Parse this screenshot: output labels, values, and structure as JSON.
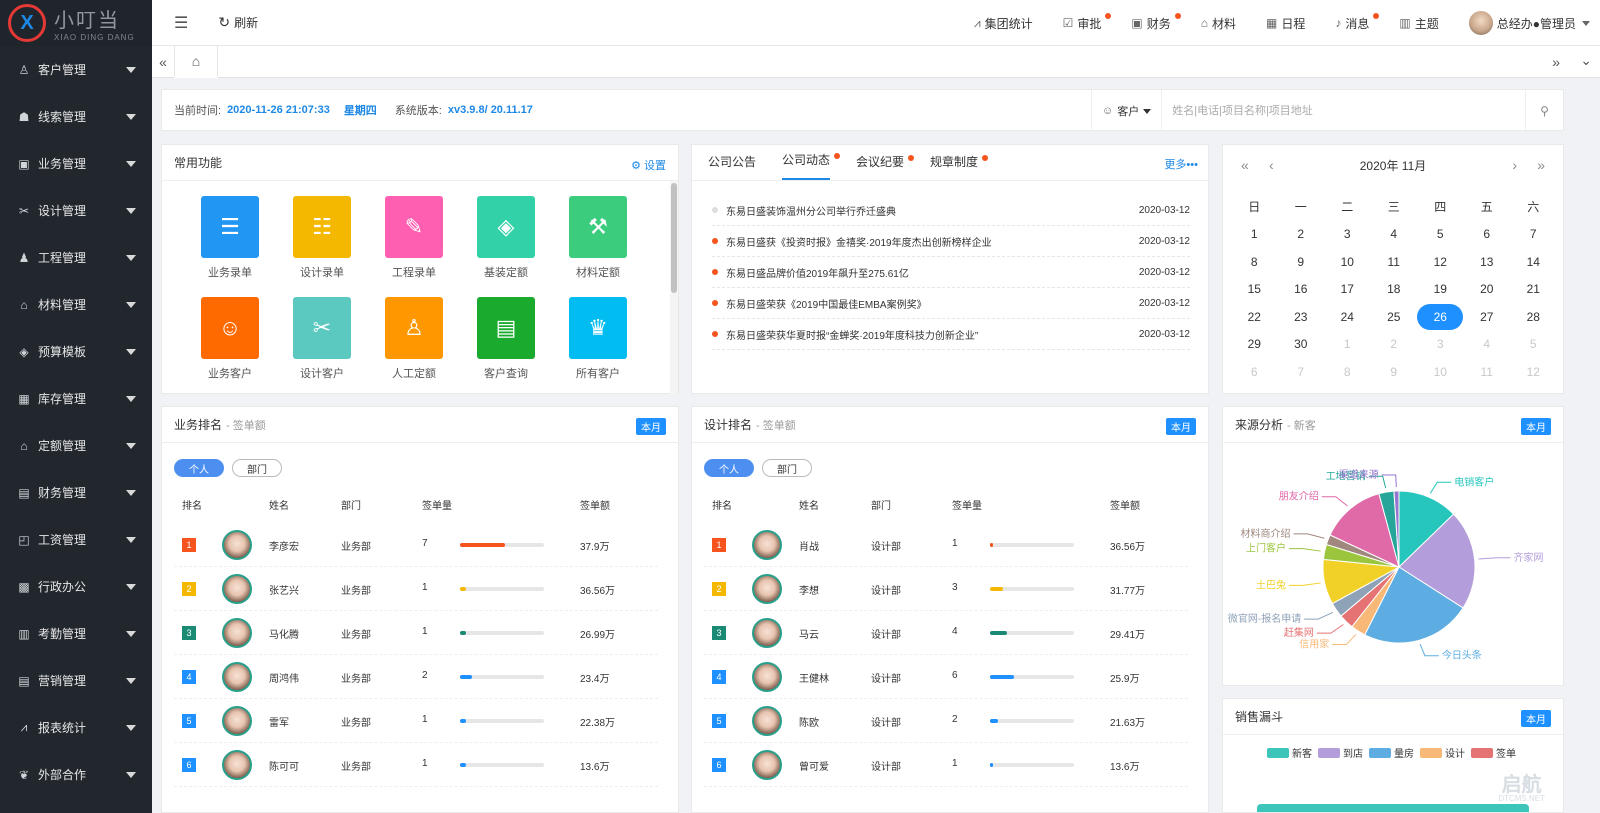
{
  "logo": {
    "title": "小叮当",
    "subtitle": "XIAO DING DANG",
    "mark": "X"
  },
  "sidebar": {
    "items": [
      {
        "label": "客户管理",
        "icon": "user-icon"
      },
      {
        "label": "线索管理",
        "icon": "lead-icon"
      },
      {
        "label": "业务管理",
        "icon": "briefcase-icon"
      },
      {
        "label": "设计管理",
        "icon": "design-icon"
      },
      {
        "label": "工程管理",
        "icon": "worker-icon"
      },
      {
        "label": "材料管理",
        "icon": "material-icon"
      },
      {
        "label": "预算模板",
        "icon": "layers-icon"
      },
      {
        "label": "库存管理",
        "icon": "inventory-icon"
      },
      {
        "label": "定额管理",
        "icon": "quota-icon"
      },
      {
        "label": "财务管理",
        "icon": "finance-icon"
      },
      {
        "label": "工资管理",
        "icon": "salary-icon"
      },
      {
        "label": "行政办公",
        "icon": "office-icon"
      },
      {
        "label": "考勤管理",
        "icon": "attendance-icon"
      },
      {
        "label": "营销管理",
        "icon": "marketing-icon"
      },
      {
        "label": "报表统计",
        "icon": "chart-icon"
      },
      {
        "label": "外部合作",
        "icon": "handshake-icon"
      }
    ]
  },
  "topbar": {
    "refresh": "刷新",
    "items": [
      {
        "label": "集团统计",
        "dot": false
      },
      {
        "label": "审批",
        "dot": true
      },
      {
        "label": "财务",
        "dot": true
      },
      {
        "label": "材料",
        "dot": false
      },
      {
        "label": "日程",
        "dot": false
      },
      {
        "label": "消息",
        "dot": true
      },
      {
        "label": "主题",
        "dot": false
      }
    ],
    "user": "总经办●管理员"
  },
  "info": {
    "time_label": "当前时间:",
    "time_value": "2020-11-26 21:07:33",
    "weekday": "星期四",
    "version_label": "系统版本:",
    "version_value": "xv3.9.8/ 20.11.17",
    "search_type": "客户",
    "search_placeholder": "姓名|电话|项目名称|项目地址"
  },
  "func": {
    "title": "常用功能",
    "settings": "设置",
    "items": [
      {
        "label": "业务录单",
        "color": "#2196f3",
        "glyph": "☰"
      },
      {
        "label": "设计录单",
        "color": "#f5b800",
        "glyph": "☷"
      },
      {
        "label": "工程录单",
        "color": "#ff5fb1",
        "glyph": "✎"
      },
      {
        "label": "基装定额",
        "color": "#33d1a8",
        "glyph": "◈"
      },
      {
        "label": "材料定额",
        "color": "#3ccc7e",
        "glyph": "⚒"
      },
      {
        "label": "业务客户",
        "color": "#ff6a00",
        "glyph": "☺"
      },
      {
        "label": "设计客户",
        "color": "#5cc9c0",
        "glyph": "✂"
      },
      {
        "label": "人工定额",
        "color": "#ff9800",
        "glyph": "♙"
      },
      {
        "label": "客户查询",
        "color": "#1aab2e",
        "glyph": "▤"
      },
      {
        "label": "所有客户",
        "color": "#00bcf0",
        "glyph": "♛"
      }
    ]
  },
  "news": {
    "tabs": [
      {
        "label": "公司公告",
        "dot": false,
        "active": false
      },
      {
        "label": "公司动态",
        "dot": true,
        "active": true
      },
      {
        "label": "会议纪要",
        "dot": true,
        "active": false
      },
      {
        "label": "规章制度",
        "dot": true,
        "active": false
      }
    ],
    "more": "更多•••",
    "items": [
      {
        "title": "东易日盛装饰温州分公司举行乔迁盛典",
        "date": "2020-03-12",
        "read": true
      },
      {
        "title": "东易日盛获《投资时报》金禧奖·2019年度杰出创新榜样企业",
        "date": "2020-03-12",
        "read": false
      },
      {
        "title": "东易日盛品牌价值2019年飙升至275.61亿",
        "date": "2020-03-12",
        "read": false
      },
      {
        "title": "东易日盛荣获《2019中国最佳EMBA案例奖》",
        "date": "2020-03-12",
        "read": false
      },
      {
        "title": "东易日盛荣获华夏时报“金蝉奖·2019年度科技力创新企业”",
        "date": "2020-03-12",
        "read": false
      }
    ]
  },
  "calendar": {
    "title": "2020年  11月",
    "weekdays": [
      "日",
      "一",
      "二",
      "三",
      "四",
      "五",
      "六"
    ],
    "days": [
      {
        "d": "1",
        "dim": false
      },
      {
        "d": "2",
        "dim": false
      },
      {
        "d": "3",
        "dim": false
      },
      {
        "d": "4",
        "dim": false
      },
      {
        "d": "5",
        "dim": false
      },
      {
        "d": "6",
        "dim": false
      },
      {
        "d": "7",
        "dim": false
      },
      {
        "d": "8",
        "dim": false
      },
      {
        "d": "9",
        "dim": false
      },
      {
        "d": "10",
        "dim": false
      },
      {
        "d": "11",
        "dim": false
      },
      {
        "d": "12",
        "dim": false
      },
      {
        "d": "13",
        "dim": false
      },
      {
        "d": "14",
        "dim": false
      },
      {
        "d": "15",
        "dim": false
      },
      {
        "d": "16",
        "dim": false
      },
      {
        "d": "17",
        "dim": false
      },
      {
        "d": "18",
        "dim": false
      },
      {
        "d": "19",
        "dim": false
      },
      {
        "d": "20",
        "dim": false
      },
      {
        "d": "21",
        "dim": false
      },
      {
        "d": "22",
        "dim": false
      },
      {
        "d": "23",
        "dim": false
      },
      {
        "d": "24",
        "dim": false
      },
      {
        "d": "25",
        "dim": false
      },
      {
        "d": "26",
        "dim": false,
        "today": true
      },
      {
        "d": "27",
        "dim": false
      },
      {
        "d": "28",
        "dim": false
      },
      {
        "d": "29",
        "dim": false
      },
      {
        "d": "30",
        "dim": false
      },
      {
        "d": "1",
        "dim": true
      },
      {
        "d": "2",
        "dim": true
      },
      {
        "d": "3",
        "dim": true
      },
      {
        "d": "4",
        "dim": true
      },
      {
        "d": "5",
        "dim": true
      },
      {
        "d": "6",
        "dim": true
      },
      {
        "d": "7",
        "dim": true
      },
      {
        "d": "8",
        "dim": true
      },
      {
        "d": "9",
        "dim": true
      },
      {
        "d": "10",
        "dim": true
      },
      {
        "d": "11",
        "dim": true
      },
      {
        "d": "12",
        "dim": true
      }
    ]
  },
  "month_badge": "本月",
  "rank_columns": {
    "rank": "排名",
    "name": "姓名",
    "dept": "部门",
    "count": "签单量",
    "amount": "签单额"
  },
  "rank_pills": [
    "个人",
    "部门"
  ],
  "rank_colors": [
    "#f5541f",
    "#f5b800",
    "#1a8a75",
    "#1e90ff",
    "#1e90ff",
    "#1e90ff"
  ],
  "biz_rank": {
    "title": "业务排名",
    "sub": "- 签单额",
    "rows": [
      {
        "rank": "1",
        "name": "李彦宏",
        "dept": "业务部",
        "count": "7",
        "amount": "37.9万",
        "progress": 0.54,
        "color": "#f5541f"
      },
      {
        "rank": "2",
        "name": "张艺兴",
        "dept": "业务部",
        "count": "1",
        "amount": "36.56万",
        "progress": 0.07,
        "color": "#f5b800"
      },
      {
        "rank": "3",
        "name": "马化腾",
        "dept": "业务部",
        "count": "1",
        "amount": "26.99万",
        "progress": 0.07,
        "color": "#1a8a75"
      },
      {
        "rank": "4",
        "name": "周鸿伟",
        "dept": "业务部",
        "count": "2",
        "amount": "23.4万",
        "progress": 0.14,
        "color": "#1e90ff"
      },
      {
        "rank": "5",
        "name": "雷军",
        "dept": "业务部",
        "count": "1",
        "amount": "22.38万",
        "progress": 0.07,
        "color": "#1e90ff"
      },
      {
        "rank": "6",
        "name": "陈可可",
        "dept": "业务部",
        "count": "1",
        "amount": "13.6万",
        "progress": 0.07,
        "color": "#1e90ff"
      }
    ]
  },
  "design_rank": {
    "title": "设计排名",
    "sub": "- 签单额",
    "rows": [
      {
        "rank": "1",
        "name": "肖战",
        "dept": "设计部",
        "count": "1",
        "amount": "36.56万",
        "progress": 0.04,
        "color": "#f5541f"
      },
      {
        "rank": "2",
        "name": "李想",
        "dept": "设计部",
        "count": "3",
        "amount": "31.77万",
        "progress": 0.15,
        "color": "#f5b800"
      },
      {
        "rank": "3",
        "name": "马云",
        "dept": "设计部",
        "count": "4",
        "amount": "29.41万",
        "progress": 0.2,
        "color": "#1a8a75"
      },
      {
        "rank": "4",
        "name": "王健林",
        "dept": "设计部",
        "count": "6",
        "amount": "25.9万",
        "progress": 0.29,
        "color": "#1e90ff"
      },
      {
        "rank": "5",
        "name": "陈欧",
        "dept": "设计部",
        "count": "2",
        "amount": "21.63万",
        "progress": 0.1,
        "color": "#1e90ff"
      },
      {
        "rank": "6",
        "name": "曾可爱",
        "dept": "设计部",
        "count": "1",
        "amount": "13.6万",
        "progress": 0.04,
        "color": "#1e90ff"
      }
    ]
  },
  "source": {
    "title": "来源分析",
    "sub": "- 新客",
    "slices": [
      {
        "name": "电销客户",
        "value": 12,
        "color": "#26c6bd"
      },
      {
        "name": "齐家网",
        "value": 20,
        "color": "#b39ddb"
      },
      {
        "name": "今日头条",
        "value": 22,
        "color": "#5dade2"
      },
      {
        "name": "信用家",
        "value": 3,
        "color": "#f8b878"
      },
      {
        "name": "赶集网",
        "value": 3,
        "color": "#e57373"
      },
      {
        "name": "微官网-报名申请",
        "value": 3,
        "color": "#8fa3b8"
      },
      {
        "name": "土巴兔",
        "value": 9,
        "color": "#f1d128"
      },
      {
        "name": "上门客户",
        "value": 3,
        "color": "#9bc53d"
      },
      {
        "name": "材料商介绍",
        "value": 2,
        "color": "#a1887f"
      },
      {
        "name": "朋友介绍",
        "value": 13,
        "color": "#e069a8"
      },
      {
        "name": "工地营销",
        "value": 3,
        "color": "#26a69a"
      },
      {
        "name": "渠道来源",
        "value": 1,
        "color": "#9575cd"
      }
    ]
  },
  "funnel": {
    "title": "销售漏斗",
    "legend": [
      {
        "name": "新客",
        "color": "#3cc5b8"
      },
      {
        "name": "到店",
        "color": "#b39ddb"
      },
      {
        "name": "量房",
        "color": "#5dade2"
      },
      {
        "name": "设计",
        "color": "#f8b878"
      },
      {
        "name": "签单",
        "color": "#e57373"
      }
    ]
  },
  "watermark": {
    "text": "启航",
    "sub": "DTCMS.NET"
  }
}
